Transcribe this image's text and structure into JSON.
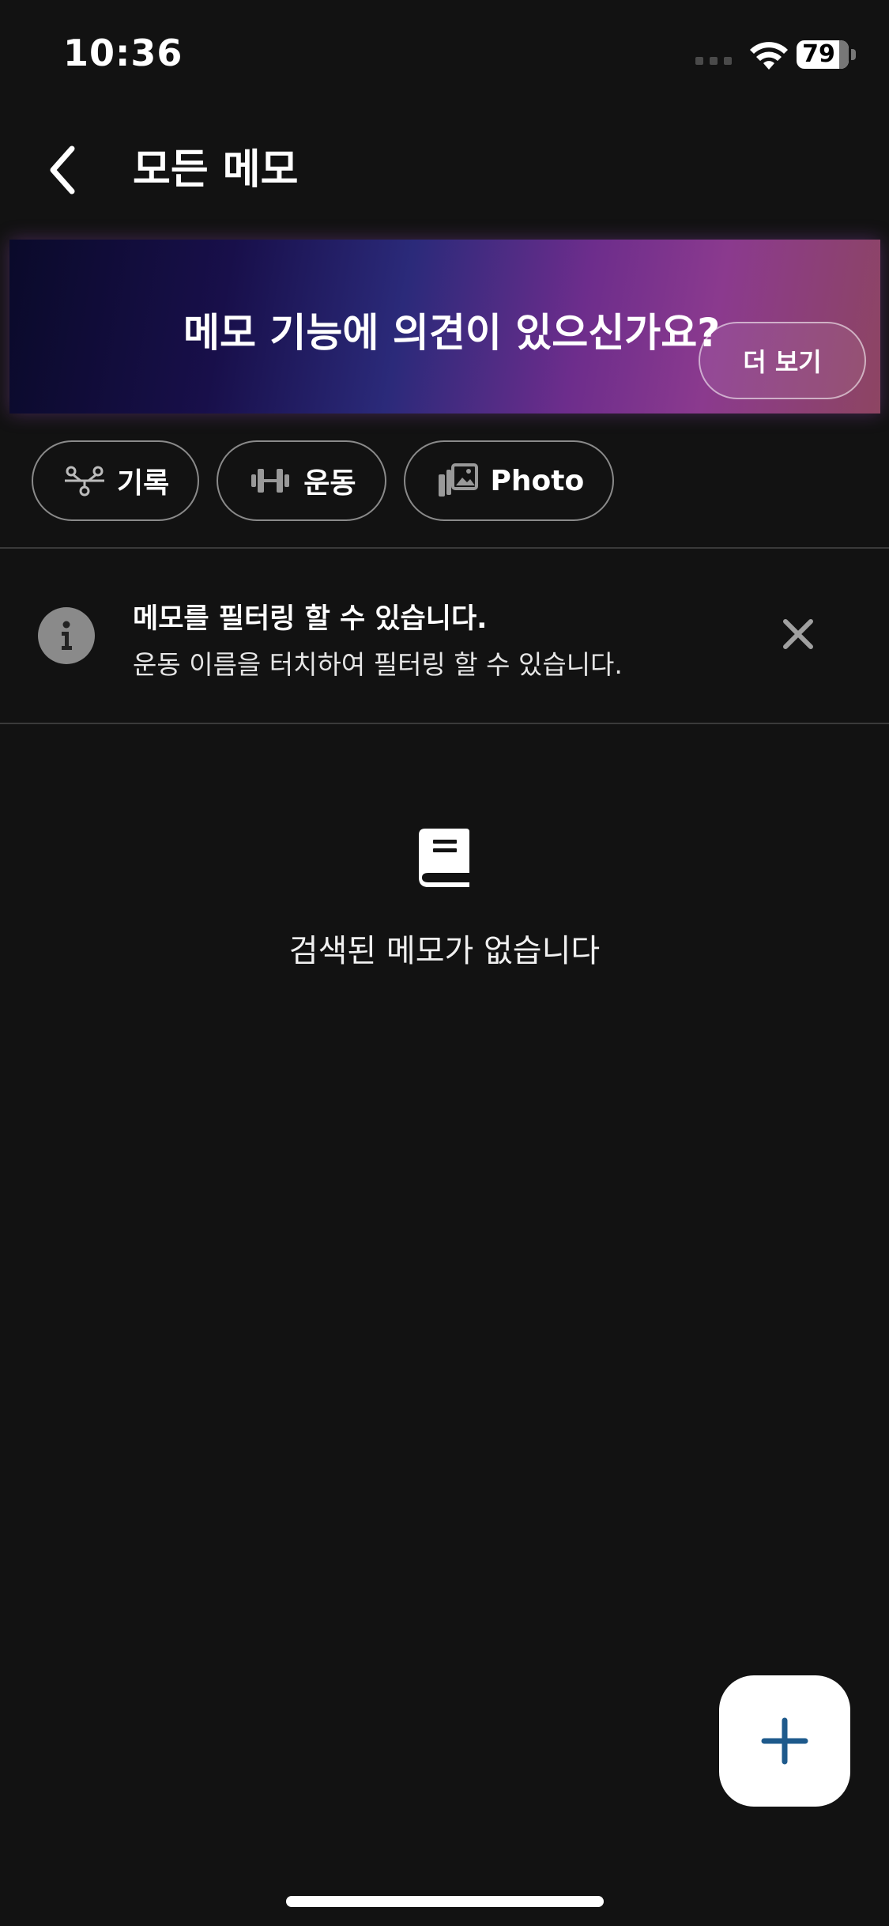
{
  "status_bar": {
    "time": "10:36",
    "battery_percent": "79",
    "icons": [
      "signal-icon",
      "wifi-icon",
      "battery-icon"
    ]
  },
  "header": {
    "back_icon": "chevron-left-icon",
    "title": "모든 메모"
  },
  "banner": {
    "title": "메모 기능에 의견이 있으신가요?",
    "button_label": "더 보기"
  },
  "filters": [
    {
      "label": "기록",
      "icon": "workout-log-icon"
    },
    {
      "label": "운동",
      "icon": "dumbbell-icon"
    },
    {
      "label": "Photo",
      "icon": "photo-library-icon"
    }
  ],
  "tip": {
    "icon": "info-icon",
    "title": "메모를 필터링 할 수 있습니다.",
    "description": "운동 이름을 터치하여 필터링 할 수 있습니다.",
    "close_icon": "close-icon"
  },
  "empty_state": {
    "icon": "notebook-icon",
    "message": "검색된 메모가 없습니다"
  },
  "fab": {
    "icon": "plus-icon"
  },
  "colors": {
    "background": "#121212",
    "chip_border": "#8a8a8a",
    "fab_background": "#ffffff",
    "fab_icon": "#1e5a8c",
    "divider": "#3a3a3a"
  }
}
